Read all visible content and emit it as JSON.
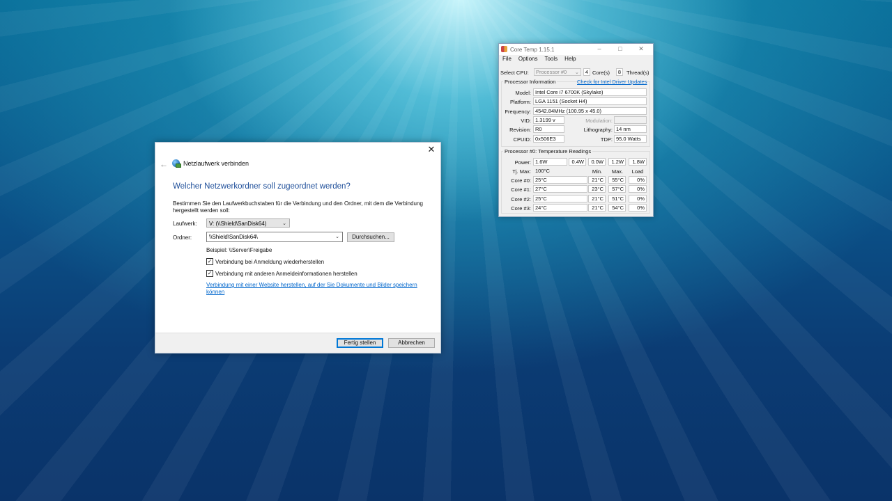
{
  "dialog": {
    "title": "Netzlaufwerk verbinden",
    "heading": "Welcher Netzwerkordner soll zugeordnet werden?",
    "description": "Bestimmen Sie den Laufwerkbuchstaben für die Verbindung und den Ordner, mit dem die Verbindung hergestellt werden soll:",
    "drive_label": "Laufwerk:",
    "drive_value": "V: (\\\\Shield\\SanDisk64)",
    "folder_label": "Ordner:",
    "folder_value": "\\\\Shield\\SanDisk64\\",
    "browse_label": "Durchsuchen...",
    "example": "Beispiel: \\\\Server\\Freigabe",
    "reconnect_label": "Verbindung bei Anmeldung wiederherstellen",
    "reconnect_checked": true,
    "other_credentials_label": "Verbindung mit anderen Anmeldeinformationen herstellen",
    "other_credentials_checked": true,
    "website_link": "Verbindung mit einer Website herstellen, auf der Sie Dokumente und Bilder speichern können",
    "finish_label": "Fertig stellen",
    "cancel_label": "Abbrechen",
    "close_glyph": "✕",
    "back_glyph": "←"
  },
  "coretemp": {
    "title": "Core Temp 1.15.1",
    "menu": [
      "File",
      "Options",
      "Tools",
      "Help"
    ],
    "select_cpu_label": "Select CPU:",
    "cpu_value": "Processor #0",
    "cores_count": "4",
    "cores_label": "Core(s)",
    "threads_count": "8",
    "threads_label": "Thread(s)",
    "proc_info_title": "Processor Information",
    "driver_link": "Check for Intel Driver Updates",
    "model_label": "Model:",
    "model_value": "Intel Core i7 6700K (Skylake)",
    "platform_label": "Platform:",
    "platform_value": "LGA 1151 (Socket H4)",
    "frequency_label": "Frequency:",
    "frequency_value": "4542.84MHz (100.95 x 45.0)",
    "vid_label": "VID:",
    "vid_value": "1.3199 v",
    "modulation_label": "Modulation:",
    "modulation_value": "",
    "revision_label": "Revision:",
    "revision_value": "R0",
    "lithography_label": "Lithography:",
    "lithography_value": "14 nm",
    "cpuid_label": "CPUID:",
    "cpuid_value": "0x506E3",
    "tdp_label": "TDP:",
    "tdp_value": "95.0 Watts",
    "temps_title": "Processor #0: Temperature Readings",
    "power_label": "Power:",
    "power_values": [
      "1.6W",
      "0.4W",
      "0.0W",
      "1.2W",
      "1.8W"
    ],
    "tjmax_label": "Tj. Max:",
    "tjmax_value": "100°C",
    "col_min": "Min.",
    "col_max": "Max.",
    "col_load": "Load",
    "cores": [
      {
        "label": "Core #0:",
        "temp": "25°C",
        "min": "21°C",
        "max": "55°C",
        "load": "0%"
      },
      {
        "label": "Core #1:",
        "temp": "27°C",
        "min": "23°C",
        "max": "57°C",
        "load": "0%"
      },
      {
        "label": "Core #2:",
        "temp": "25°C",
        "min": "21°C",
        "max": "51°C",
        "load": "0%"
      },
      {
        "label": "Core #3:",
        "temp": "24°C",
        "min": "21°C",
        "max": "54°C",
        "load": "0%"
      }
    ]
  }
}
